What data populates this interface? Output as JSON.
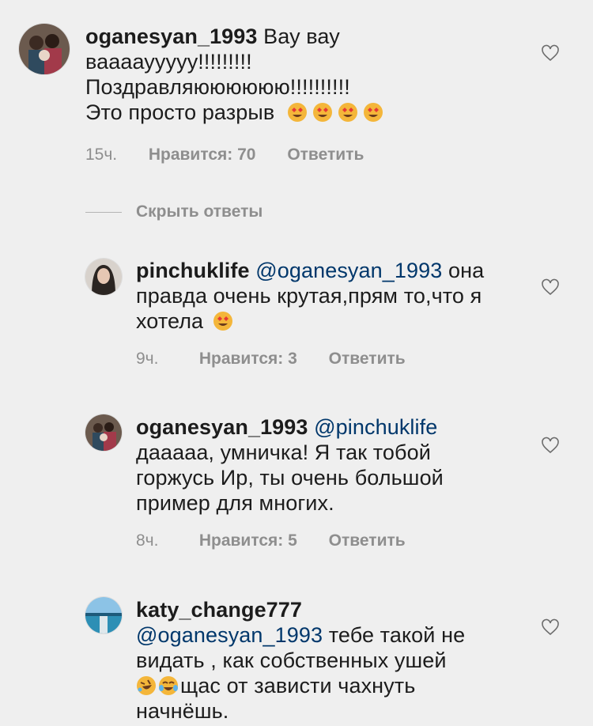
{
  "comments": [
    {
      "username": "oganesyan_1993",
      "text_line1": "Вау вау",
      "text_line2": "вааааууууу!!!!!!!!!",
      "text_line3": "Поздравляюююююю!!!!!!!!!!",
      "text_line4": "Это просто разрыв",
      "emojis": [
        "heart-eyes",
        "heart-eyes",
        "heart-eyes",
        "heart-eyes"
      ],
      "time": "15ч.",
      "likes": "Нравится: 70",
      "reply": "Ответить"
    },
    {
      "username": "pinchuklife",
      "mention": "@oganesyan_1993",
      "text_line1": "она",
      "text_line2": "правда очень крутая,прям то,что я",
      "text_line3": "хотела",
      "emojis": [
        "heart-eyes"
      ],
      "time": "9ч.",
      "likes": "Нравится: 3",
      "reply": "Ответить"
    },
    {
      "username": "oganesyan_1993",
      "mention": "@pinchuklife",
      "text_line2": "дааааа, умничка! Я так тобой",
      "text_line3": "горжусь Ир, ты очень большой",
      "text_line4": "пример для многих.",
      "time": "8ч.",
      "likes": "Нравится: 5",
      "reply": "Ответить"
    },
    {
      "username": "katy_change777",
      "mention": "@oganesyan_1993",
      "text_line1": "тебе такой не",
      "text_line2": "видать , как собственных ушей",
      "text_line3": "щас от зависти чахнуть",
      "text_line4": "начнёшь.",
      "emojis": [
        "rolling-laughing",
        "tears-of-joy"
      ]
    }
  ],
  "hide_replies_label": "Скрыть ответы",
  "icons": {
    "like": "heart-outline-icon"
  },
  "colors": {
    "background": "#efefef",
    "mention": "#00376b",
    "meta": "#8e8e8e"
  }
}
